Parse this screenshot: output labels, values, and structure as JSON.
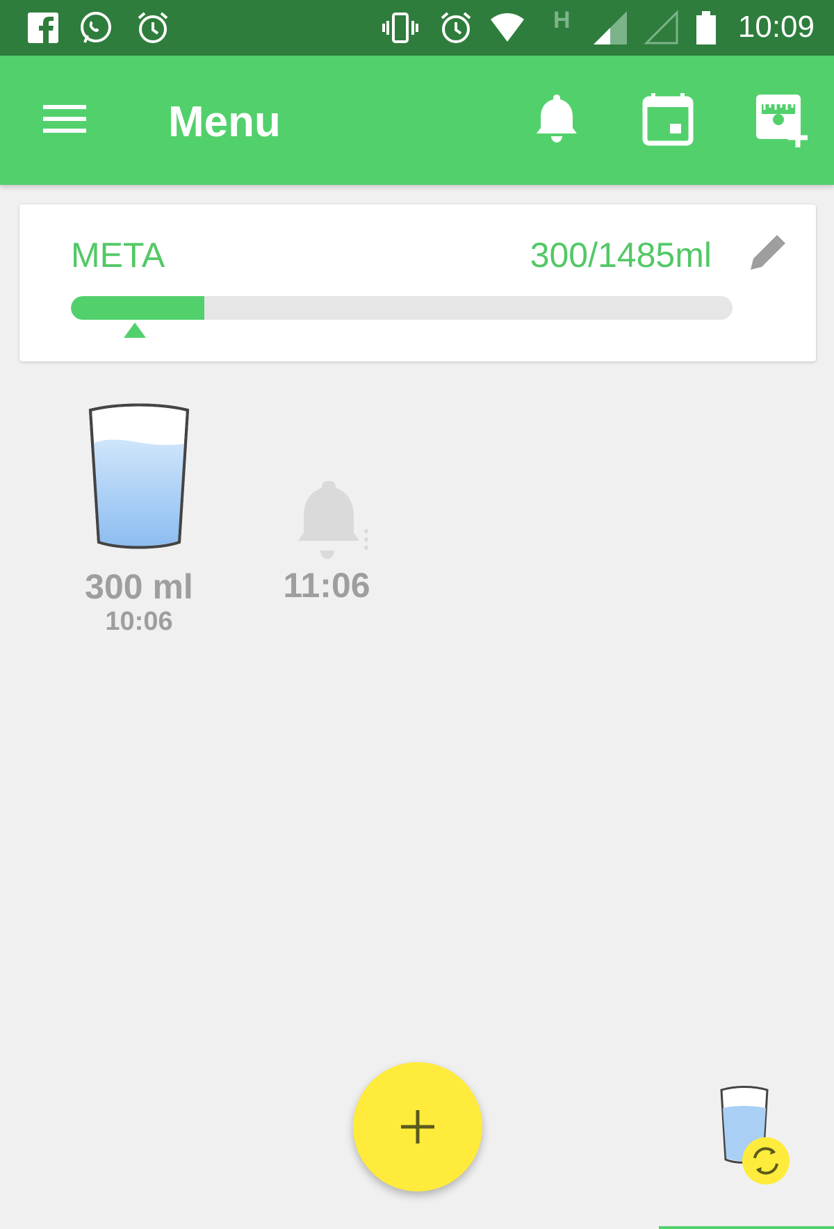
{
  "status_bar": {
    "time": "10:09",
    "network_label": "H",
    "left_icons": [
      "facebook-icon",
      "whatsapp-icon",
      "alarm-icon"
    ],
    "right_icons": [
      "vibrate-icon",
      "alarm-icon",
      "wifi-icon",
      "network-h-icon",
      "signal-icon",
      "signal-empty-icon",
      "battery-icon"
    ]
  },
  "app_bar": {
    "title": "Menu",
    "actions": [
      "bell-icon",
      "calendar-icon",
      "cup-size-add-icon"
    ]
  },
  "goal": {
    "label": "META",
    "amount": "300/1485ml",
    "progress_fraction": 0.202
  },
  "entries": [
    {
      "amount": "300 ml",
      "time": "10:06",
      "icon": "water-glass-icon"
    },
    {
      "time": "11:06",
      "icon": "reminder-bell-icon"
    }
  ],
  "fab": {
    "icon": "plus-icon"
  },
  "cup_switch": {
    "icon": "switch-cup-icon"
  },
  "colors": {
    "status_bar": "#2e7d3c",
    "app_bar": "#52d06c",
    "accent_green": "#52c866",
    "fab": "#ffeb3b",
    "water": "#90c4f3"
  }
}
